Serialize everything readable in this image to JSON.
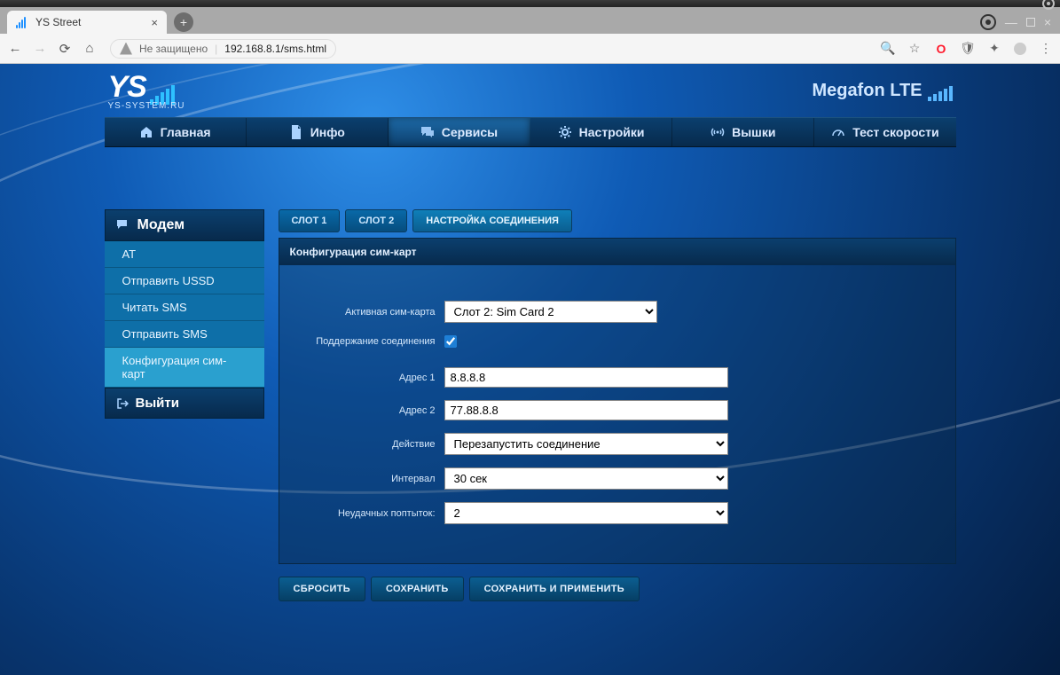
{
  "os": {
    "target_color": "#333"
  },
  "browser": {
    "tab_title": "YS Street",
    "security_label": "Не защищено",
    "url": "192.168.8.1/sms.html"
  },
  "brand": {
    "logo_text": "YS",
    "logo_sub": "YS-SYSTEM.RU"
  },
  "carrier": {
    "text": "Megafon LTE"
  },
  "topnav": {
    "items": [
      {
        "label": "Главная"
      },
      {
        "label": "Инфо"
      },
      {
        "label": "Сервисы"
      },
      {
        "label": "Настройки"
      },
      {
        "label": "Вышки"
      },
      {
        "label": "Тест скорости"
      }
    ],
    "active_index": 2
  },
  "sidebar": {
    "header": "Модем",
    "items": [
      {
        "label": "АТ"
      },
      {
        "label": "Отправить USSD"
      },
      {
        "label": "Читать SMS"
      },
      {
        "label": "Отправить SMS"
      },
      {
        "label": "Конфигурация сим-карт"
      }
    ],
    "active_index": 4,
    "exit": "Выйти"
  },
  "subtabs": {
    "items": [
      {
        "label": "СЛОТ 1"
      },
      {
        "label": "СЛОТ 2"
      },
      {
        "label": "НАСТРОЙКА СОЕДИНЕНИЯ"
      }
    ],
    "active_index": 2
  },
  "panel": {
    "title": "Конфигурация сим-карт",
    "labels": {
      "active_sim": "Активная сим-карта",
      "keep_conn": "Поддержание соединения",
      "addr1": "Адрес 1",
      "addr2": "Адрес 2",
      "action": "Действие",
      "interval": "Интервал",
      "fail_attempts": "Неудачных поптыток:"
    },
    "values": {
      "active_sim": "Слот 2: Sim Card 2",
      "keep_conn_checked": true,
      "addr1": "8.8.8.8",
      "addr2": "77.88.8.8",
      "action": "Перезапустить соединение",
      "interval": "30 сек",
      "fail_attempts": "2"
    }
  },
  "buttons": {
    "reset": "СБРОСИТЬ",
    "save": "СОХРАНИТЬ",
    "save_apply": "СОХРАНИТЬ И ПРИМЕНИТЬ"
  }
}
